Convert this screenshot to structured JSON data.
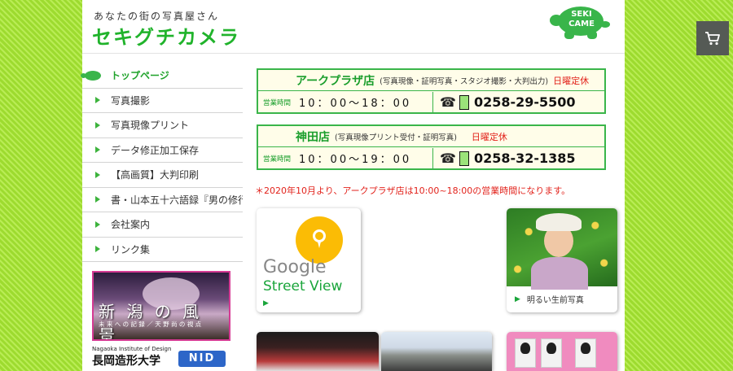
{
  "header": {
    "tagline": "あなたの街の写真屋さん",
    "logo_text": "セキグチカメラ",
    "mascot_text_line1": "SEKI",
    "mascot_text_line2": "CAME"
  },
  "cart": {
    "icon": "cart-icon"
  },
  "sidebar": {
    "items": [
      {
        "label": "トップページ",
        "active": true
      },
      {
        "label": "写真撮影"
      },
      {
        "label": "写真現像プリント"
      },
      {
        "label": "データ修正加工保存"
      },
      {
        "label": "【高画質】大判印刷"
      },
      {
        "label": "書・山本五十六語録『男の修行』"
      },
      {
        "label": "会社案内"
      },
      {
        "label": "リンク集"
      }
    ],
    "banner_niigata": {
      "title": "新 潟 の 風 景",
      "subtitle": "未 来 へ の 記 録 ／ 天 野 尚 の 視 点"
    },
    "banner_nid": {
      "english": "Nagaoka Institute of Design",
      "japanese": "長岡造形大学",
      "badge": "NID"
    }
  },
  "stores": [
    {
      "name": "アークプラザ店",
      "services": "(写真現像・証明写真・スタジオ撮影・大判出力)",
      "closed": "日曜定休",
      "hours_label": "営業時間",
      "hours": "10：00〜18：00",
      "phone": "0258-29-5500"
    },
    {
      "name": "神田店",
      "services": "(写真現像プリント受付・証明写真)",
      "closed": "日曜定休",
      "hours_label": "営業時間",
      "hours": "10：00〜19：00",
      "phone": "0258-32-1385"
    }
  ],
  "notice": "＊2020年10月より、アークプラザ店は10:00~18:00の営業時間になります。",
  "cards": {
    "street_view": {
      "google": "Google",
      "street": "Street View"
    },
    "portrait": {
      "caption": "明るい生前写真"
    }
  },
  "colors": {
    "accent_green": "#20b32b",
    "alert_red": "#e2221b",
    "background_lime": "#a6e23a"
  }
}
